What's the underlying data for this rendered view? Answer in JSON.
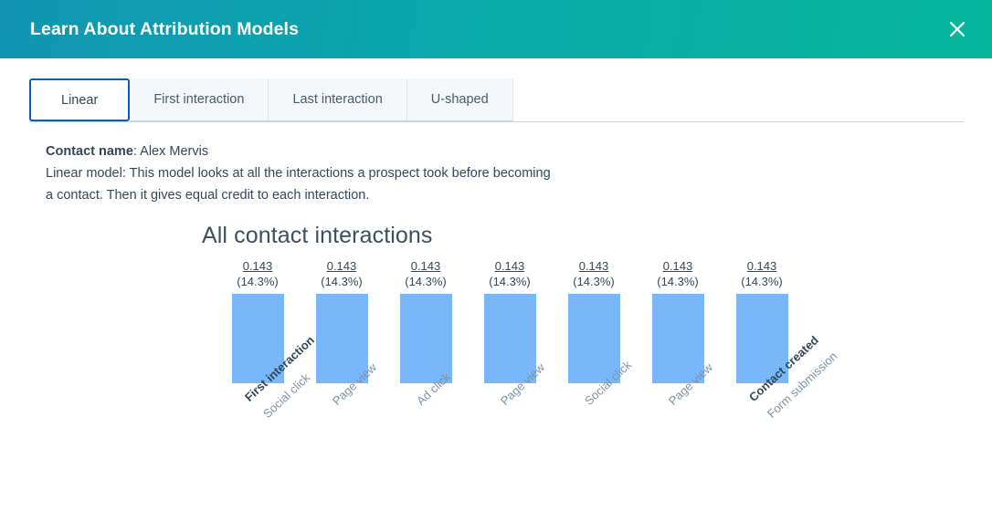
{
  "header": {
    "title": "Learn About Attribution Models",
    "close_icon": "close-icon",
    "gradient_from": "#1196b2",
    "gradient_to": "#07b79b"
  },
  "tabs": [
    {
      "label": "Linear",
      "active": true
    },
    {
      "label": "First interaction",
      "active": false
    },
    {
      "label": "Last interaction",
      "active": false
    },
    {
      "label": "U-shaped",
      "active": false
    }
  ],
  "description": {
    "contact_label": "Contact name",
    "contact_separator": ": ",
    "contact_value": "Alex Mervis",
    "model_text": "Linear model: This model looks at all the interactions a prospect took before becoming a contact. Then it gives equal credit to each interaction."
  },
  "chart_data": {
    "type": "bar",
    "title": "All contact interactions",
    "xlabel": "",
    "ylabel": "",
    "ylim": [
      0,
      0.143
    ],
    "grid": false,
    "legend": null,
    "bar_color": "#79b7f8",
    "categories": [
      "Social click",
      "Page view",
      "Ad click",
      "Page view",
      "Social click",
      "Page view",
      "Form submission"
    ],
    "values": [
      0.143,
      0.143,
      0.143,
      0.143,
      0.143,
      0.143,
      0.143
    ],
    "value_labels": [
      "0.143",
      "0.143",
      "0.143",
      "0.143",
      "0.143",
      "0.143",
      "0.143"
    ],
    "percent_labels": [
      "(14.3%)",
      "(14.3%)",
      "(14.3%)",
      "(14.3%)",
      "(14.3%)",
      "(14.3%)",
      "(14.3%)"
    ],
    "percents": [
      14.3,
      14.3,
      14.3,
      14.3,
      14.3,
      14.3,
      14.3
    ],
    "annotations": [
      {
        "index": 0,
        "text": "First interaction"
      },
      {
        "index": 6,
        "text": "Contact created"
      }
    ]
  }
}
